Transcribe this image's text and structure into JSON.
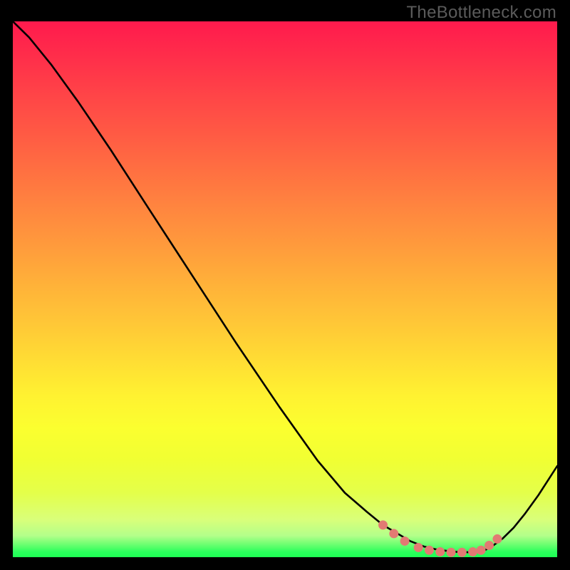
{
  "brand": "TheBottleneck.com",
  "chart_data": {
    "type": "line",
    "title": "",
    "xlabel": "",
    "ylabel": "",
    "xlim": [
      0,
      100
    ],
    "ylim": [
      0,
      100
    ],
    "background_gradient": [
      "#ff1a4d",
      "#2bff5c"
    ],
    "series": [
      {
        "name": "curve",
        "color": "#000000",
        "x": [
          0.0,
          3.0,
          7.0,
          12.0,
          18.0,
          25.0,
          33.0,
          41.0,
          49.0,
          56.0,
          61.0,
          65.0,
          68.0,
          71.0,
          73.0,
          75.5,
          78.0,
          81.0,
          84.0,
          86.5,
          88.0,
          90.0,
          92.0,
          94.0,
          96.5,
          100.0
        ],
        "y": [
          100.0,
          97.0,
          92.0,
          85.0,
          76.0,
          65.0,
          52.5,
          40.0,
          28.0,
          18.0,
          12.0,
          8.5,
          6.0,
          4.2,
          3.0,
          2.0,
          1.4,
          1.0,
          0.9,
          1.2,
          2.0,
          3.5,
          5.5,
          8.0,
          11.5,
          17.0
        ]
      }
    ],
    "markers": {
      "color": "#e27a73",
      "radius_px": 6.5,
      "points_xy": [
        [
          68.0,
          6.0
        ],
        [
          70.0,
          4.4
        ],
        [
          72.0,
          3.0
        ],
        [
          74.5,
          1.8
        ],
        [
          76.5,
          1.3
        ],
        [
          78.5,
          1.0
        ],
        [
          80.5,
          0.9
        ],
        [
          82.5,
          0.9
        ],
        [
          84.5,
          1.0
        ],
        [
          86.0,
          1.3
        ],
        [
          87.5,
          2.2
        ],
        [
          89.0,
          3.4
        ]
      ]
    }
  }
}
